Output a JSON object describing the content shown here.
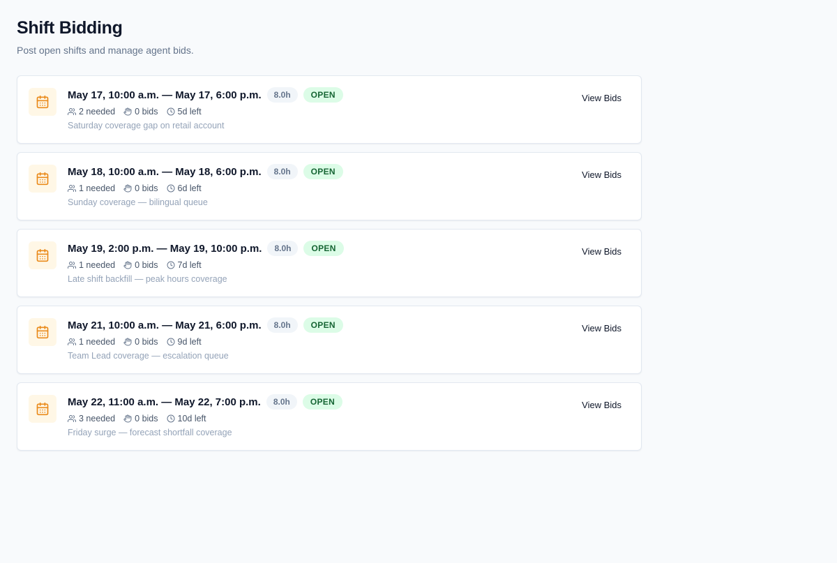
{
  "page": {
    "title": "Shift Bidding",
    "subtitle": "Post open shifts and manage agent bids."
  },
  "icons": {
    "card": "calendar-icon",
    "needed": "users-icon",
    "bids": "hand-icon",
    "time_left": "clock-icon"
  },
  "colors": {
    "accent_orange": "#ea8a1a",
    "open_badge_bg": "#dcfce7",
    "open_badge_text": "#166534"
  },
  "shifts": [
    {
      "range": "May 17, 10:00 a.m. — May 17, 6:00 p.m.",
      "hours": "8.0h",
      "status": "OPEN",
      "needed": "2 needed",
      "bids": "0 bids",
      "time_left": "5d left",
      "note": "Saturday coverage gap on retail account",
      "action": "View Bids"
    },
    {
      "range": "May 18, 10:00 a.m. — May 18, 6:00 p.m.",
      "hours": "8.0h",
      "status": "OPEN",
      "needed": "1 needed",
      "bids": "0 bids",
      "time_left": "6d left",
      "note": "Sunday coverage — bilingual queue",
      "action": "View Bids"
    },
    {
      "range": "May 19, 2:00 p.m. — May 19, 10:00 p.m.",
      "hours": "8.0h",
      "status": "OPEN",
      "needed": "1 needed",
      "bids": "0 bids",
      "time_left": "7d left",
      "note": "Late shift backfill — peak hours coverage",
      "action": "View Bids"
    },
    {
      "range": "May 21, 10:00 a.m. — May 21, 6:00 p.m.",
      "hours": "8.0h",
      "status": "OPEN",
      "needed": "1 needed",
      "bids": "0 bids",
      "time_left": "9d left",
      "note": "Team Lead coverage — escalation queue",
      "action": "View Bids"
    },
    {
      "range": "May 22, 11:00 a.m. — May 22, 7:00 p.m.",
      "hours": "8.0h",
      "status": "OPEN",
      "needed": "3 needed",
      "bids": "0 bids",
      "time_left": "10d left",
      "note": "Friday surge — forecast shortfall coverage",
      "action": "View Bids"
    }
  ]
}
